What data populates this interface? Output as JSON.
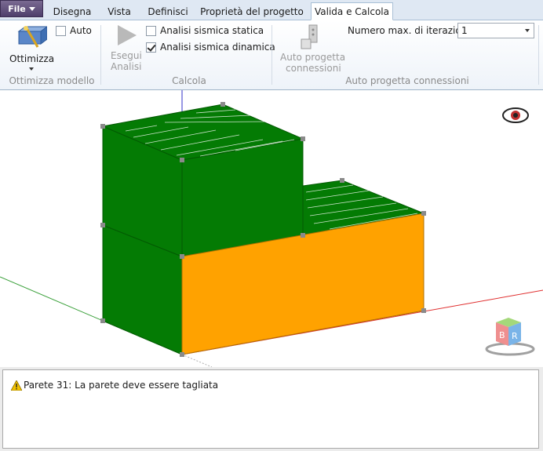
{
  "tabs": {
    "file": "File",
    "items": [
      "Disegna",
      "Vista",
      "Definisci",
      "Proprietà del progetto",
      "Valida e Calcola"
    ],
    "active": "Valida e Calcola"
  },
  "ribbon": {
    "optimize": {
      "button_label": "Ottimizza",
      "auto_label": "Auto",
      "group_label": "Ottimizza modello"
    },
    "calc": {
      "run_label_line1": "Esegui",
      "run_label_line2": "Analisi",
      "static_label": "Analisi sismica statica",
      "dynamic_label": "Analisi sismica dinamica",
      "static_checked": false,
      "dynamic_checked": true,
      "group_label": "Calcola"
    },
    "connections": {
      "button_line1": "Auto progetta",
      "button_line2": "connessioni",
      "iterations_label": "Numero max. di iterazioni",
      "iterations_value": "1",
      "group_label": "Auto progetta connessioni"
    }
  },
  "viewport": {
    "colors": {
      "wall_green": "#047b04",
      "wall_orange": "#ffa200",
      "axis_x": "#e03030",
      "axis_y": "#30a030",
      "axis_z": "#3030d0"
    },
    "cube_letters": {
      "left": "B",
      "right": "R"
    }
  },
  "messages": [
    {
      "icon": "warning-icon",
      "text": "Parete 31: La parete deve essere tagliata"
    }
  ]
}
